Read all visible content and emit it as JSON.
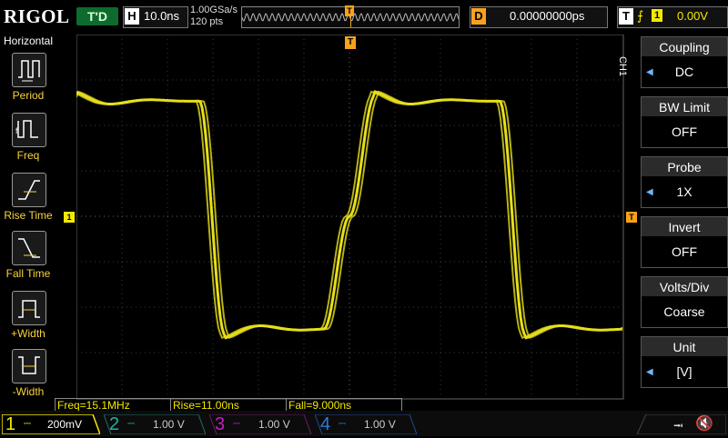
{
  "brand": "RIGOL",
  "run_state": "T'D",
  "horizontal": {
    "key": "H",
    "timebase": "10.0ns",
    "sample_rate": "1.00GSa/s",
    "points": "120 pts"
  },
  "trigger_marker": "T",
  "delay": {
    "key": "D",
    "value": "0.00000000ps"
  },
  "trigger": {
    "key": "T",
    "edge": "⨍",
    "channel": "1",
    "level": "0.00V"
  },
  "left_menu": {
    "title": "Horizontal",
    "items": [
      {
        "label": "Period"
      },
      {
        "label": "Freq"
      },
      {
        "label": "Rise Time"
      },
      {
        "label": "Fall Time"
      },
      {
        "label": "+Width"
      },
      {
        "label": "-Width"
      }
    ]
  },
  "right_menu": {
    "channel": "CH1",
    "items": [
      {
        "title": "Coupling",
        "value": "DC",
        "arrow": true
      },
      {
        "title": "BW Limit",
        "value": "OFF",
        "arrow": false
      },
      {
        "title": "Probe",
        "value": "1X",
        "arrow": true
      },
      {
        "title": "Invert",
        "value": "OFF",
        "arrow": false
      },
      {
        "title": "Volts/Div",
        "value": "Coarse",
        "arrow": false
      },
      {
        "title": "Unit",
        "value": "[V]",
        "arrow": true
      }
    ]
  },
  "measurements": [
    {
      "text": "Freq=15.1MHz"
    },
    {
      "text": "Rise=11.00ns"
    },
    {
      "text": "Fall=9.000ns"
    }
  ],
  "channels": [
    {
      "num": "1",
      "scale": "200mV",
      "color": "#f3e800"
    },
    {
      "num": "2",
      "scale": "1.00 V",
      "color": "#1fb3a6"
    },
    {
      "num": "3",
      "scale": "1.00 V",
      "color": "#c01fbf"
    },
    {
      "num": "4",
      "scale": "1.00 V",
      "color": "#2a7be0"
    }
  ],
  "waveform_color": "#e6de1a",
  "grid_color": "#3a3a3a"
}
